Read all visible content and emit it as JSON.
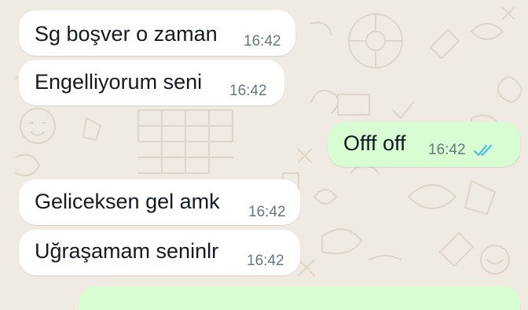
{
  "conversation": {
    "messages": [
      {
        "direction": "incoming",
        "text": "Sg boşver o zaman",
        "time": "16:42"
      },
      {
        "direction": "incoming",
        "text": "Engelliyorum seni",
        "time": "16:42"
      },
      {
        "direction": "outgoing",
        "text": "Offf off",
        "time": "16:42",
        "status_icon": "double-check-read-icon"
      },
      {
        "direction": "incoming",
        "text": "Geliceksen gel amk",
        "time": "16:42"
      },
      {
        "direction": "incoming",
        "text": "Uğraşamam seninlr",
        "time": "16:42"
      }
    ]
  },
  "colors": {
    "background": "#efeae2",
    "incoming_bubble": "#ffffff",
    "outgoing_bubble": "#d9fdd3",
    "read_ticks": "#53bdeb",
    "timestamp": "#667781"
  }
}
